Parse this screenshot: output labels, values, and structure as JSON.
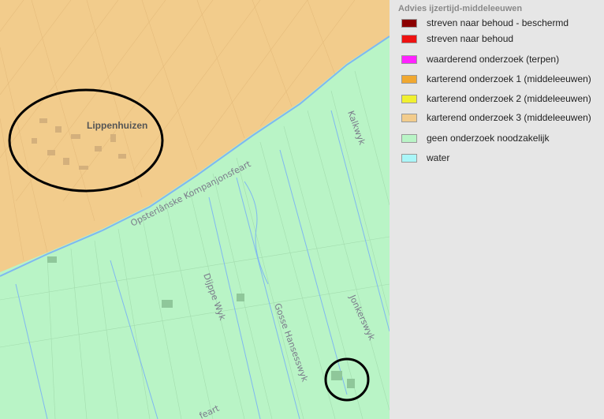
{
  "map": {
    "place_label": "Lippenhuizen",
    "road_labels": {
      "kompanjonsfeart": "Opsterlânske Kompanjonsfeart",
      "kalkwyk": "Kalkwyk",
      "dijppe_wyk": "Dijppe Wyk",
      "gosse_hansesswyk": "Gosse Hansesswyk",
      "jonkerswyk": "Jonkerswyk",
      "feart_bottom": "feart"
    },
    "colors": {
      "orange_zone": "#f2cc8c",
      "green_zone": "#b9f4c6",
      "water": "#7fb8f0",
      "circle": "#000000"
    }
  },
  "legend": {
    "title": "Advies ijzertijd-middeleeuwen",
    "items": [
      {
        "label": "streven naar behoud - beschermd",
        "color": "#8b0000"
      },
      {
        "label": "streven naar behoud",
        "color": "#ee1111"
      },
      {
        "label": "waarderend onderzoek (terpen)",
        "color": "#ff22ff"
      },
      {
        "label": "karterend onderzoek 1 (middeleeuwen)",
        "color": "#f0a830"
      },
      {
        "label": "karterend onderzoek 2 (middeleeuwen)",
        "color": "#f0f030"
      },
      {
        "label": "karterend onderzoek 3 (middeleeuwen)",
        "color": "#f2cc8c"
      },
      {
        "label": "geen onderzoek noodzakelijk",
        "color": "#b9f4c6"
      },
      {
        "label": "water",
        "color": "#aaf6f8"
      }
    ]
  }
}
